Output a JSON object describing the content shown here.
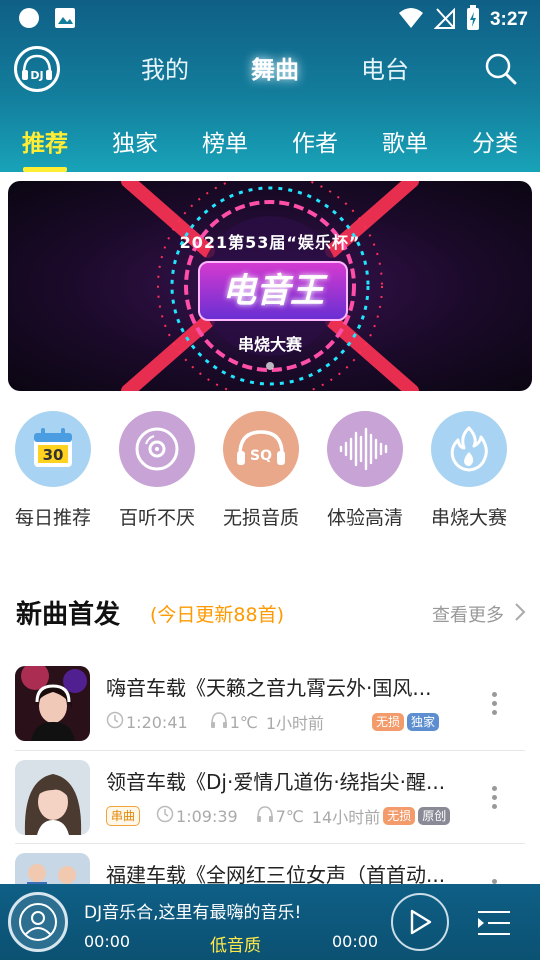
{
  "status_bar": {
    "time": "3:27"
  },
  "header": {
    "logo_text": "DJ",
    "main_tabs": [
      {
        "label": "我的"
      },
      {
        "label": "舞曲"
      },
      {
        "label": "电台"
      }
    ],
    "active_main_tab": 1
  },
  "sub_tabs": [
    {
      "label": "推荐"
    },
    {
      "label": "独家"
    },
    {
      "label": "榜单"
    },
    {
      "label": "作者"
    },
    {
      "label": "歌单"
    },
    {
      "label": "分类"
    }
  ],
  "banner": {
    "title": "2021第53届“娱乐杯”",
    "main": "电音王",
    "sub": "串烧大赛"
  },
  "categories": [
    {
      "label": "每日推荐",
      "icon": "calendar-icon",
      "color": "#a8d3f2",
      "badge": "30"
    },
    {
      "label": "百听不厌",
      "icon": "disc-icon",
      "color": "#c7a3d6"
    },
    {
      "label": "无损音质",
      "icon": "headphones-sq-icon",
      "color": "#e8a889",
      "badge": "SQ"
    },
    {
      "label": "体验高清",
      "icon": "waveform-icon",
      "color": "#c7a3d6"
    },
    {
      "label": "串烧大赛",
      "icon": "flame-icon",
      "color": "#a8d3f2"
    }
  ],
  "section": {
    "title": "新曲首发",
    "subtitle": "(今日更新88首)",
    "more": "查看更多"
  },
  "songs": [
    {
      "title": "嗨音车载《天籁之音九霄云外·国风...",
      "duration": "1:20:41",
      "listens": "1℃",
      "ago": "1小时前",
      "tags": [
        "无损",
        "独家"
      ]
    },
    {
      "title": "领音车载《Dj·爱情几道伤·绕指尖·醒...",
      "prefix_tag": "串曲",
      "duration": "1:09:39",
      "listens": "7℃",
      "ago": "14小时前",
      "tags": [
        "无损",
        "原创"
      ]
    },
    {
      "title": "福建车载《全网红三位女声（首首动..."
    }
  ],
  "player": {
    "now_playing": "DJ音乐合,这里有最嗨的音乐!",
    "time_current": "00:00",
    "quality": "低音质",
    "time_total": "00:00"
  },
  "colors": {
    "header": "#137d9c",
    "accent": "#ffee33",
    "orange": "#ff9900"
  }
}
